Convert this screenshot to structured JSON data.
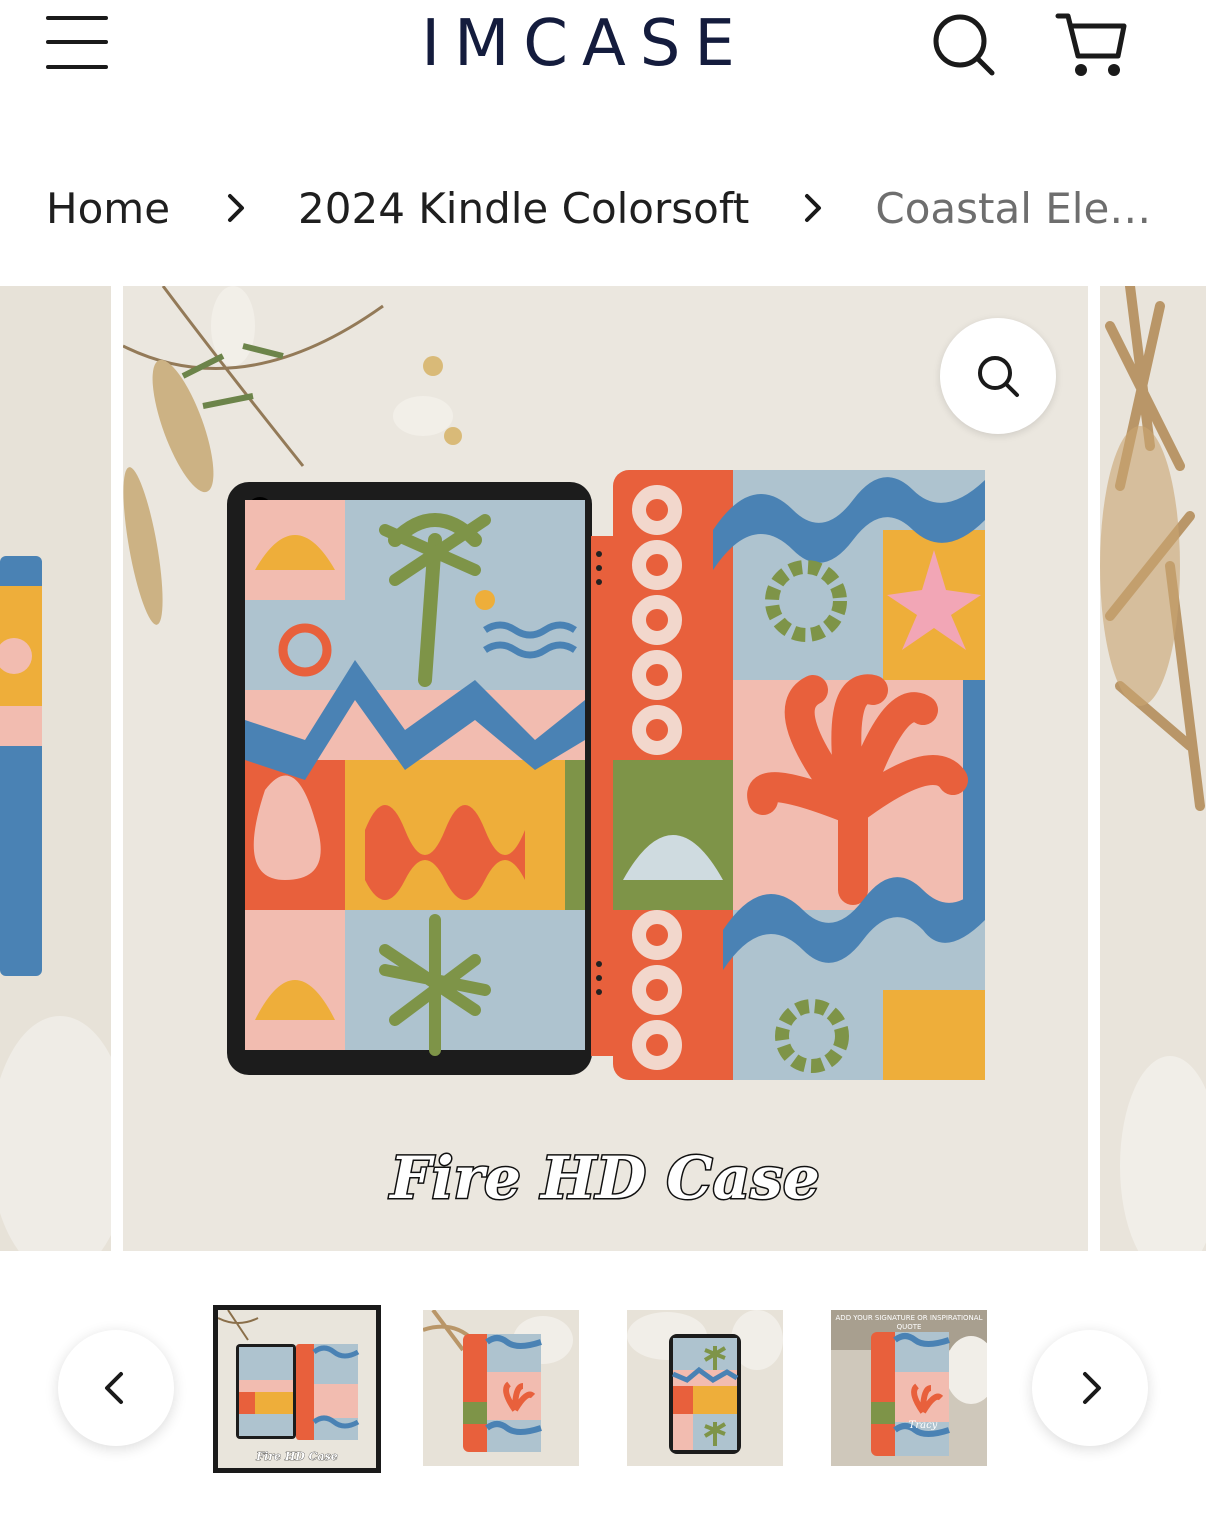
{
  "header": {
    "logo": "IMCASE",
    "menu_icon": "hamburger-menu-icon",
    "search_icon": "search-icon",
    "cart_icon": "cart-icon"
  },
  "breadcrumb": {
    "items": [
      "Home",
      "2024 Kindle Colorsoft",
      "Coastal Eleg..."
    ]
  },
  "gallery": {
    "main_caption": "Fire HD Case",
    "zoom_icon": "zoom-icon"
  },
  "thumbnails": {
    "items": [
      {
        "caption": "Fire HD Case"
      },
      {
        "caption": ""
      },
      {
        "caption": ""
      },
      {
        "overlay": "ADD YOUR SIGNATURE OR INSPIRATIONAL QUOTE",
        "script": "Tracy"
      }
    ],
    "prev_icon": "chevron-left-icon",
    "next_icon": "chevron-right-icon"
  },
  "colors": {
    "logo": "#141c3d",
    "coral": "#e8603c",
    "sky_blue": "#aec3cf",
    "ocean_blue": "#4a82b4",
    "mustard": "#eeae3a",
    "olive": "#7e9448",
    "blush": "#f2bcb0"
  }
}
